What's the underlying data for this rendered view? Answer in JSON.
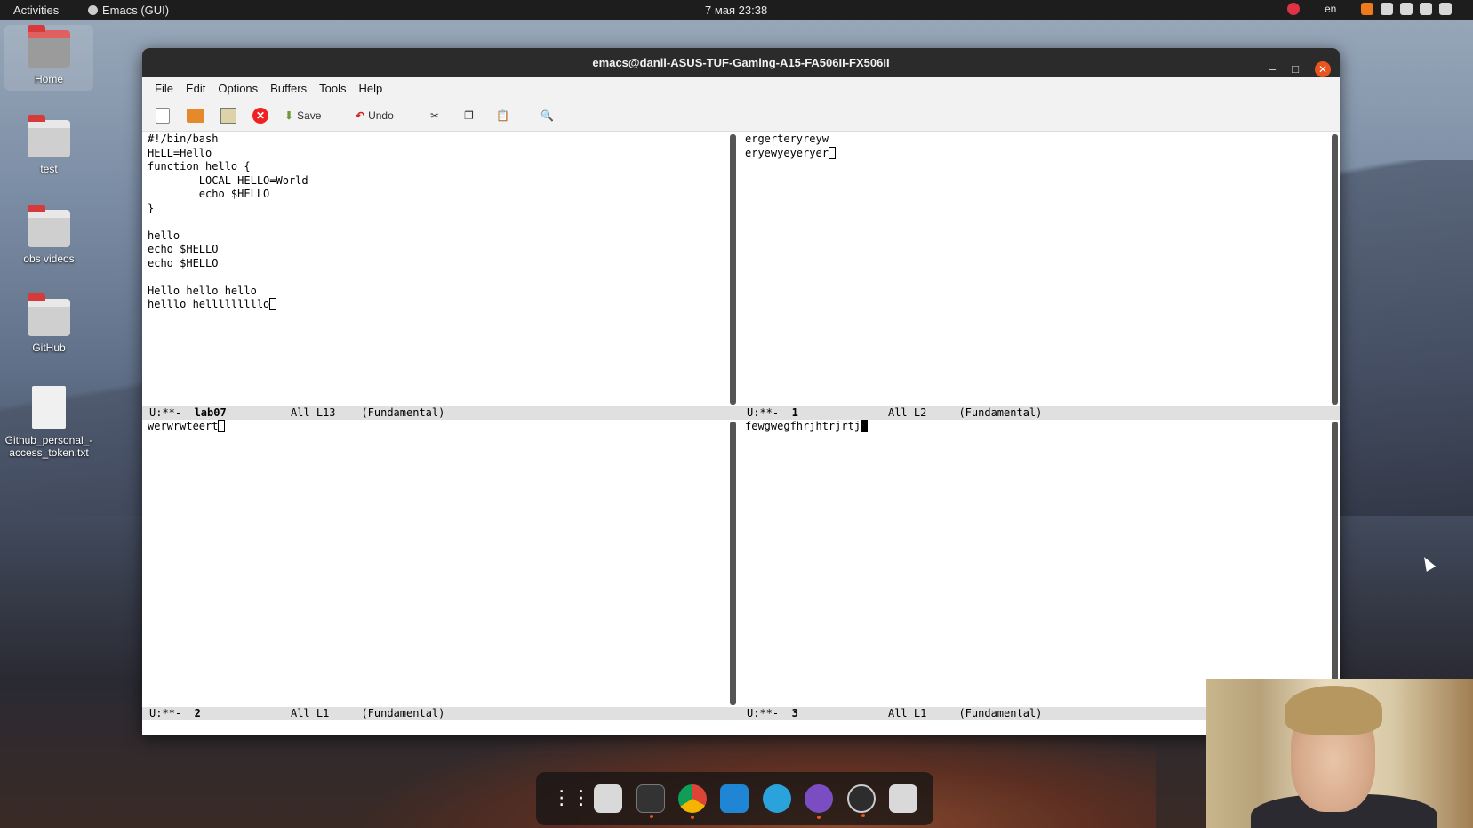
{
  "topbar": {
    "activities": "Activities",
    "app_name": "Emacs (GUI)",
    "clock": "7 мая  23:38",
    "lang": "en"
  },
  "desktop": {
    "icons": [
      {
        "label": "Home"
      },
      {
        "label": "test"
      },
      {
        "label": "obs videos"
      },
      {
        "label": "GitHub"
      },
      {
        "label": "Github_personal_-\naccess_token.txt"
      }
    ]
  },
  "window": {
    "title": "emacs@danil-ASUS-TUF-Gaming-A15-FA506II-FX506II",
    "minimize": "–",
    "maximize": "□",
    "close": "✕"
  },
  "menubar": {
    "items": [
      "File",
      "Edit",
      "Options",
      "Buffers",
      "Tools",
      "Help"
    ]
  },
  "toolbar": {
    "save_label": "Save",
    "undo_label": "Undo"
  },
  "panes": {
    "top_left": {
      "text": "#!/bin/bash\nHELL=Hello\nfunction hello {\n        LOCAL HELLO=World\n        echo $HELLO\n}\n\nhello\necho $HELLO\necho $HELLO\n\nHello hello hello\nhelllo helllllllllo",
      "mode": {
        "status": "U:**-",
        "buffer": "lab07",
        "pos": "All L13",
        "major": "(Fundamental)"
      }
    },
    "top_right": {
      "text": "ergerteryreyw\neryewyeyeryer",
      "mode": {
        "status": "U:**-",
        "buffer": "1",
        "pos": "All L2",
        "major": "(Fundamental)"
      }
    },
    "bottom_left": {
      "text": "werwrwteert",
      "mode": {
        "status": "U:**-",
        "buffer": "2",
        "pos": "All L1",
        "major": "(Fundamental)"
      }
    },
    "bottom_right": {
      "text": "fewgwegfhrjhtrjrtj",
      "mode": {
        "status": "U:**-",
        "buffer": "3",
        "pos": "All L1",
        "major": "(Fundamental)"
      }
    }
  },
  "dock": {
    "apps": [
      "app-grid",
      "files",
      "terminal",
      "chrome",
      "vscode",
      "telegram",
      "emacs",
      "obs",
      "trash"
    ]
  },
  "colors": {
    "accent": "#e95420",
    "titlebar": "#2b2b2b",
    "modeline": "#e0e0e0"
  }
}
